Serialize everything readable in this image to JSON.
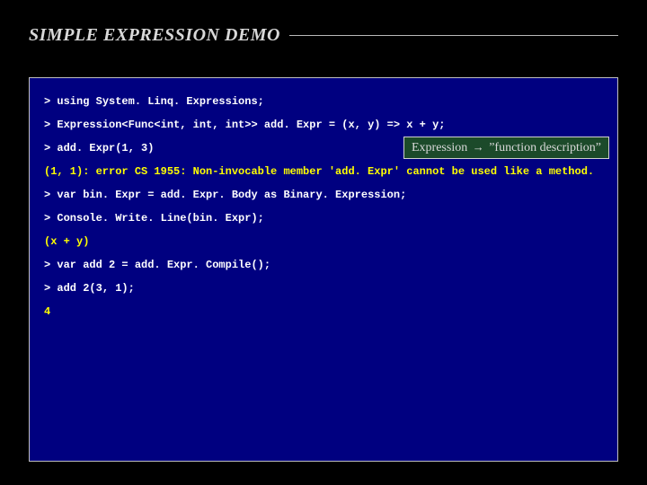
{
  "title": "SIMPLE EXPRESSION DEMO",
  "console": {
    "prompt": "> ",
    "lines": [
      {
        "kind": "input",
        "text": "using System. Linq. Expressions;"
      },
      {
        "kind": "input",
        "text": "Expression<Func<int, int, int>> add. Expr = (x, y) => x + y;"
      },
      {
        "kind": "input",
        "text": "add. Expr(1, 3)"
      },
      {
        "kind": "error",
        "text": "(1, 1): error CS 1955: Non-invocable member 'add. Expr' cannot be used like a method."
      },
      {
        "kind": "input",
        "text": "var bin. Expr = add. Expr. Body as Binary. Expression;"
      },
      {
        "kind": "input",
        "text": "Console. Write. Line(bin. Expr);"
      },
      {
        "kind": "output",
        "text": "(x + y)"
      },
      {
        "kind": "input",
        "text": "var add 2 = add. Expr. Compile();"
      },
      {
        "kind": "input",
        "text": "add 2(3, 1);"
      },
      {
        "kind": "output",
        "text": "4"
      }
    ]
  },
  "callout": {
    "prefix": "Expression ",
    "arrow": "→",
    "suffix": " ”function description”"
  }
}
